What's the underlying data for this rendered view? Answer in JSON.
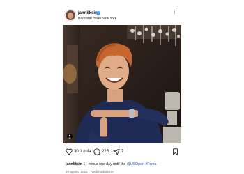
{
  "post": {
    "username": "jannliksin",
    "location": "Baccarat Hotel New York",
    "photo_alt": "Jannik Sinner smiling in a navy sweater making a timeout gesture",
    "likes": "30,1 mila",
    "comments": "225",
    "shares": "7",
    "caption": {
      "username": "jannliksin",
      "text_before": "1 - minus one day until the",
      "mention": "@USOpen",
      "hashtag": "#Forza"
    },
    "date": "28 agosto 2022",
    "translate": "Vedi traduzione"
  },
  "icons": {
    "like": "heart-icon",
    "comment": "comment-icon",
    "share": "send-icon",
    "save": "bookmark-icon",
    "more": "more-icon",
    "verified": "verified-badge-icon",
    "user_tag": "user-tag-icon"
  },
  "colors": {
    "verified": "#3897f0",
    "link": "#2a5db0",
    "muted": "#777777"
  }
}
